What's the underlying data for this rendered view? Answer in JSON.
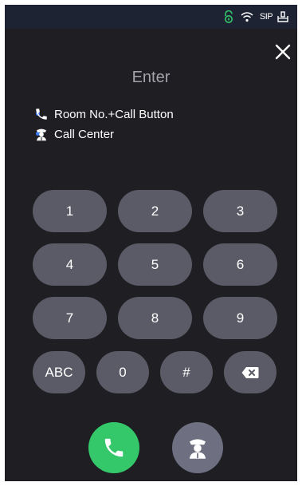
{
  "status_bar": {
    "icons": [
      "unlock-icon",
      "wifi-icon",
      "sip-icon",
      "storage-icon"
    ],
    "sip_text": "SIP",
    "accent_color": "#34c86b"
  },
  "header": {
    "title": "Enter",
    "close_icon": "close-icon"
  },
  "hints": [
    {
      "icon": "phone-icon",
      "text": "Room No.+Call Button"
    },
    {
      "icon": "guard-icon",
      "text": "Call Center"
    }
  ],
  "keypad": {
    "rows": [
      [
        "1",
        "2",
        "3"
      ],
      [
        "4",
        "5",
        "6"
      ],
      [
        "7",
        "8",
        "9"
      ],
      [
        "ABC",
        "0",
        "#",
        "backspace"
      ]
    ],
    "key_color": "#5b5b67"
  },
  "actions": {
    "call_icon": "phone-icon",
    "call_color": "#34c86b",
    "call_center_icon": "guard-icon",
    "call_center_color": "#6e7082"
  }
}
